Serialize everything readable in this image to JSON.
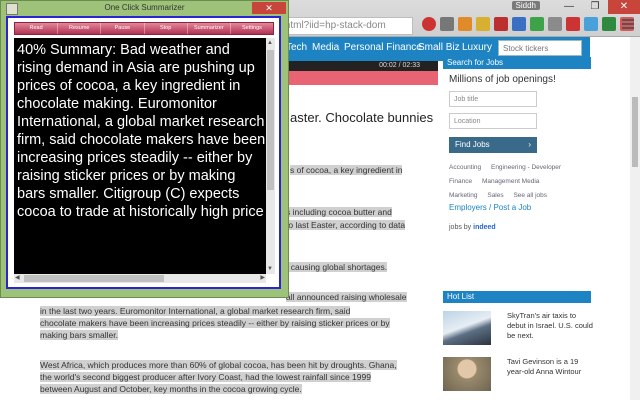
{
  "browser": {
    "url_fragment": ".html?iid=hp-stack-dom",
    "user_label": "Siddh",
    "window_controls": [
      "—",
      "❐",
      "✕"
    ]
  },
  "popup": {
    "title": "One Click Summarizer",
    "close_label": "✕",
    "toolbar": [
      "Read",
      "Resume",
      "Pause",
      "Stop",
      "Summarizer",
      "Settings"
    ],
    "summary_text": "40% Summary: Bad weather and rising demand in Asia are pushing up prices of cocoa, a key ingredient in chocolate making. Euromonitor International, a global market research firm, said chocolate makers have been increasing prices steadily -- either by raising sticker prices or by making bars smaller. Citigroup (C) expects cocoa to trade at historically high price"
  },
  "site": {
    "nav": [
      "Tech",
      "Media",
      "Personal Finance",
      "Small Biz",
      "Luxury"
    ],
    "stock_placeholder": "Stock tickers",
    "video_time": "00:02 / 02:33",
    "article_title_fragment": "aster. Chocolate bunnies",
    "snippets": [
      "s of cocoa, a key ingredient in",
      "s including cocoa butter and",
      "to last Easter, according to data",
      ", causing global shortages."
    ],
    "paragraphs": [
      "all announced raising wholesale",
      "in the last two years. Euromonitor International, a global market research firm, said",
      "chocolate makers have been increasing prices steadily -- either by raising sticker prices or by",
      "making bars smaller.",
      "West Africa, which produces more than 60% of global cocoa, has been hit by droughts. Ghana,",
      "the world's second biggest producer after Ivory Coast, had the lowest rainfall since 1999",
      "between August and October, key months in the cocoa growing cycle."
    ]
  },
  "jobs": {
    "header": "Search for Jobs",
    "title": "Millions of job openings!",
    "job_title_placeholder": "Job title",
    "location_placeholder": "Location",
    "find_button": "Find Jobs",
    "links": [
      "Accounting",
      "Engineering - Developer",
      "Finance",
      "Management Media",
      "Marketing",
      "Sales",
      "See all jobs"
    ],
    "employer_link": "Employers / Post a Job",
    "powered_prefix": "jobs by",
    "powered_brand": "indeed"
  },
  "hotlist": {
    "header": "Hot List",
    "items": [
      {
        "text": "SkyTran's air taxis to debut in Israel. U.S. could be next."
      },
      {
        "text": "Tavi Gevinson is a 19 year-old Anna Wintour"
      }
    ]
  },
  "colors": {
    "nav_blue": "#1d83c3",
    "popup_green": "#9ec27a",
    "popup_border_blue": "#2a24d6",
    "toolbar_pink": "#c0415f"
  }
}
